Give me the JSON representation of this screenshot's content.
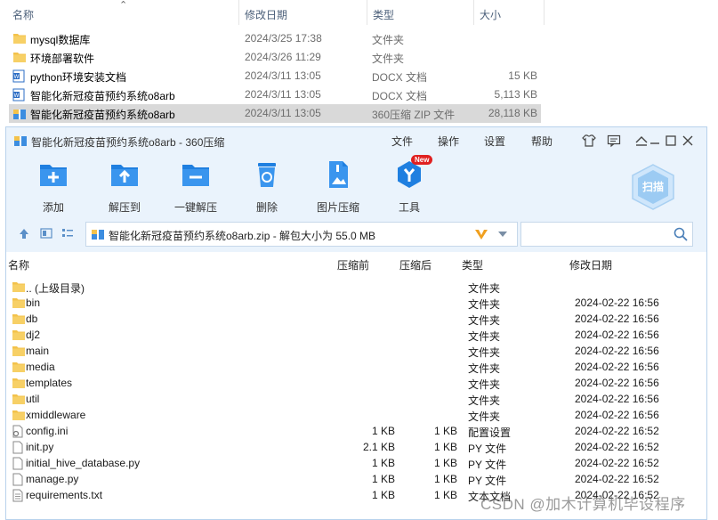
{
  "explorer": {
    "columns": {
      "name": "名称",
      "date": "修改日期",
      "type": "类型",
      "size": "大小"
    },
    "rows": [
      {
        "name": "mysql数据库",
        "date": "2024/3/25 17:38",
        "type": "文件夹",
        "size": "",
        "icon": "folder"
      },
      {
        "name": "环境部署软件",
        "date": "2024/3/26 11:29",
        "type": "文件夹",
        "size": "",
        "icon": "folder"
      },
      {
        "name": "python环境安装文档",
        "date": "2024/3/11 13:05",
        "type": "DOCX 文档",
        "size": "15 KB",
        "icon": "word"
      },
      {
        "name": "智能化新冠疫苗预约系统o8arb",
        "date": "2024/3/11 13:05",
        "type": "DOCX 文档",
        "size": "5,113 KB",
        "icon": "word"
      },
      {
        "name": "智能化新冠疫苗预约系统o8arb",
        "date": "2024/3/11 13:05",
        "type": "360压缩 ZIP 文件",
        "size": "28,118 KB",
        "icon": "zip",
        "selected": true
      }
    ]
  },
  "window": {
    "title": "智能化新冠疫苗预约系统o8arb - 360压缩",
    "menu": [
      "文件",
      "操作",
      "设置",
      "帮助"
    ],
    "toolbar": [
      {
        "label": "添加",
        "icon": "add-icon"
      },
      {
        "label": "解压到",
        "icon": "extract-to-icon"
      },
      {
        "label": "一键解压",
        "icon": "one-click-extract-icon"
      },
      {
        "label": "删除",
        "icon": "delete-icon"
      },
      {
        "label": "图片压缩",
        "icon": "image-compress-icon"
      },
      {
        "label": "工具",
        "icon": "tools-icon"
      }
    ],
    "new_badge": "New",
    "scan_label": "扫描",
    "address": "智能化新冠疫苗预约系统o8arb.zip - 解包大小为 55.0 MB",
    "list_columns": {
      "name": "名称",
      "compressed": "压缩前",
      "packed": "压缩后",
      "type": "类型",
      "date": "修改日期"
    },
    "list_rows": [
      {
        "name": ".. (上级目录)",
        "before": "",
        "after": "",
        "type": "文件夹",
        "date": "",
        "icon": "folder"
      },
      {
        "name": "bin",
        "before": "",
        "after": "",
        "type": "文件夹",
        "date": "2024-02-22 16:56",
        "icon": "folder"
      },
      {
        "name": "db",
        "before": "",
        "after": "",
        "type": "文件夹",
        "date": "2024-02-22 16:56",
        "icon": "folder"
      },
      {
        "name": "dj2",
        "before": "",
        "after": "",
        "type": "文件夹",
        "date": "2024-02-22 16:56",
        "icon": "folder"
      },
      {
        "name": "main",
        "before": "",
        "after": "",
        "type": "文件夹",
        "date": "2024-02-22 16:56",
        "icon": "folder"
      },
      {
        "name": "media",
        "before": "",
        "after": "",
        "type": "文件夹",
        "date": "2024-02-22 16:56",
        "icon": "folder"
      },
      {
        "name": "templates",
        "before": "",
        "after": "",
        "type": "文件夹",
        "date": "2024-02-22 16:56",
        "icon": "folder"
      },
      {
        "name": "util",
        "before": "",
        "after": "",
        "type": "文件夹",
        "date": "2024-02-22 16:56",
        "icon": "folder"
      },
      {
        "name": "xmiddleware",
        "before": "",
        "after": "",
        "type": "文件夹",
        "date": "2024-02-22 16:56",
        "icon": "folder"
      },
      {
        "name": "config.ini",
        "before": "1 KB",
        "after": "1 KB",
        "type": "配置设置",
        "date": "2024-02-22 16:52",
        "icon": "config"
      },
      {
        "name": "init.py",
        "before": "2.1 KB",
        "after": "1 KB",
        "type": "PY 文件",
        "date": "2024-02-22 16:52",
        "icon": "file"
      },
      {
        "name": "initial_hive_database.py",
        "before": "1 KB",
        "after": "1 KB",
        "type": "PY 文件",
        "date": "2024-02-22 16:52",
        "icon": "file"
      },
      {
        "name": "manage.py",
        "before": "1 KB",
        "after": "1 KB",
        "type": "PY 文件",
        "date": "2024-02-22 16:52",
        "icon": "file"
      },
      {
        "name": "requirements.txt",
        "before": "1 KB",
        "after": "1 KB",
        "type": "文本文档",
        "date": "2024-02-22 16:52",
        "icon": "text"
      }
    ]
  },
  "watermark": "CSDN @加木计算机毕设程序",
  "colors": {
    "accent": "#1f7fe0",
    "folder": "#f3c24b",
    "badge": "#e02020",
    "selected_row": "#d9d9d9"
  }
}
